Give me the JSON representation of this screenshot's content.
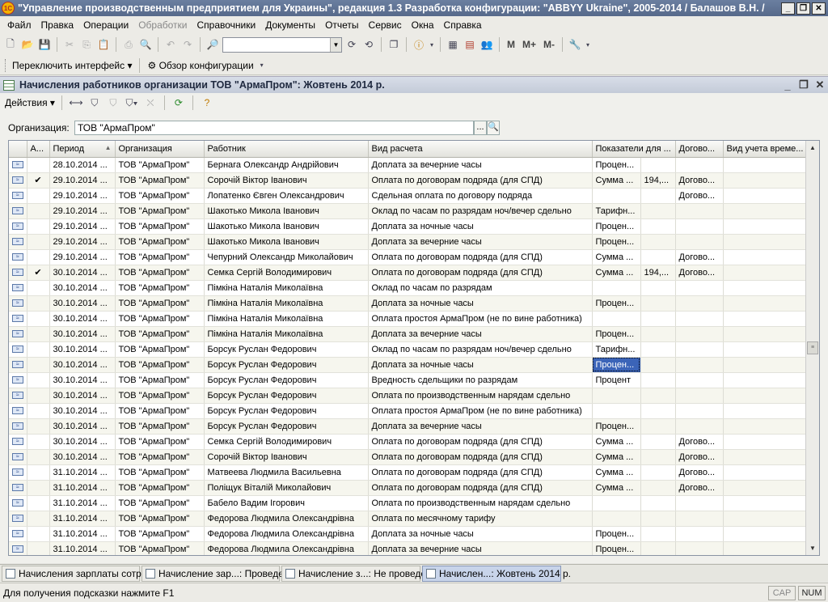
{
  "app": {
    "title": "\"Управление производственным предприятием для Украины\", редакция 1.3 Разработка конфигурации: \"ABBYY Ukraine\", 2005-2014 / Балашов В.Н. /",
    "logo_text": "1С"
  },
  "menu": [
    "Файл",
    "Правка",
    "Операции",
    "Обработки",
    "Справочники",
    "Документы",
    "Отчеты",
    "Сервис",
    "Окна",
    "Справка"
  ],
  "toolbar2": {
    "switch_interface": "Переключить интерфейс",
    "config_overview": "Обзор конфигурации"
  },
  "toolbar1": {
    "memory": [
      "M",
      "M+",
      "M-"
    ]
  },
  "document": {
    "title": "Начисления работников организации ТОВ \"АрмаПром\": Жовтень 2014 р.",
    "actions_label": "Действия",
    "org_label": "Организация:",
    "org_value": "ТОВ \"АрмаПром\"",
    "org_select": "...",
    "columns": [
      "А...",
      "Период",
      "Организация",
      "Работник",
      "Вид расчета",
      "Показатели для ...",
      "Догово...",
      "Вид учета време..."
    ],
    "rows": [
      {
        "a": "",
        "period": "28.10.2014 ...",
        "org": "ТОВ \"АрмаПром\"",
        "worker": "Бернага Олександр Андрійович",
        "calc": "Доплата за вечерние часы",
        "ind": "Процен...",
        "ind2": "",
        "contract": "",
        "time": ""
      },
      {
        "a": "✔",
        "period": "29.10.2014 ...",
        "org": "ТОВ \"АрмаПром\"",
        "worker": "Сорочій Віктор Іванович",
        "calc": "Оплата по договорам подряда (для СПД)",
        "ind": "Сумма ...",
        "ind2": "194,...",
        "contract": "Догово...",
        "time": ""
      },
      {
        "a": "",
        "period": "29.10.2014 ...",
        "org": "ТОВ \"АрмаПром\"",
        "worker": "Лопатенко Євген Олександрович",
        "calc": "Сдельная оплата по договору подряда",
        "ind": "",
        "ind2": "",
        "contract": "Догово...",
        "time": ""
      },
      {
        "a": "",
        "period": "29.10.2014 ...",
        "org": "ТОВ \"АрмаПром\"",
        "worker": "Шакотько Микола Іванович",
        "calc": "Оклад по часам по разрядам ноч/вечер сдельно",
        "ind": "Тарифн...",
        "ind2": "",
        "contract": "",
        "time": ""
      },
      {
        "a": "",
        "period": "29.10.2014 ...",
        "org": "ТОВ \"АрмаПром\"",
        "worker": "Шакотько Микола Іванович",
        "calc": "Доплата за ночные часы",
        "ind": "Процен...",
        "ind2": "",
        "contract": "",
        "time": ""
      },
      {
        "a": "",
        "period": "29.10.2014 ...",
        "org": "ТОВ \"АрмаПром\"",
        "worker": "Шакотько Микола Іванович",
        "calc": "Доплата за вечерние часы",
        "ind": "Процен...",
        "ind2": "",
        "contract": "",
        "time": ""
      },
      {
        "a": "",
        "period": "29.10.2014 ...",
        "org": "ТОВ \"АрмаПром\"",
        "worker": "Чепурний Олександр Миколайович",
        "calc": "Оплата по договорам подряда (для СПД)",
        "ind": "Сумма ...",
        "ind2": "",
        "contract": "Догово...",
        "time": ""
      },
      {
        "a": "✔",
        "period": "30.10.2014 ...",
        "org": "ТОВ \"АрмаПром\"",
        "worker": "Семка Сергій Володимирович",
        "calc": "Оплата по договорам подряда (для СПД)",
        "ind": "Сумма ...",
        "ind2": "194,...",
        "contract": "Догово...",
        "time": ""
      },
      {
        "a": "",
        "period": "30.10.2014 ...",
        "org": "ТОВ \"АрмаПром\"",
        "worker": "Пімкіна Наталія Миколаївна",
        "calc": "Оклад по часам по разрядам",
        "ind": "",
        "ind2": "",
        "contract": "",
        "time": ""
      },
      {
        "a": "",
        "period": "30.10.2014 ...",
        "org": "ТОВ \"АрмаПром\"",
        "worker": "Пімкіна Наталія Миколаївна",
        "calc": "Доплата за ночные часы",
        "ind": "Процен...",
        "ind2": "",
        "contract": "",
        "time": ""
      },
      {
        "a": "",
        "period": "30.10.2014 ...",
        "org": "ТОВ \"АрмаПром\"",
        "worker": "Пімкіна Наталія Миколаївна",
        "calc": "Оплата простоя АрмаПром (не по вине работника)",
        "ind": "",
        "ind2": "",
        "contract": "",
        "time": ""
      },
      {
        "a": "",
        "period": "30.10.2014 ...",
        "org": "ТОВ \"АрмаПром\"",
        "worker": "Пімкіна Наталія Миколаївна",
        "calc": "Доплата за вечерние часы",
        "ind": "Процен...",
        "ind2": "",
        "contract": "",
        "time": ""
      },
      {
        "a": "",
        "period": "30.10.2014 ...",
        "org": "ТОВ \"АрмаПром\"",
        "worker": "Борсук Руслан Федорович",
        "calc": "Оклад по часам по разрядам ноч/вечер сдельно",
        "ind": "Тарифн...",
        "ind2": "",
        "contract": "",
        "time": ""
      },
      {
        "a": "",
        "period": "30.10.2014 ...",
        "org": "ТОВ \"АрмаПром\"",
        "worker": "Борсук Руслан Федорович",
        "calc": "Доплата за ночные часы",
        "ind": "Процен...",
        "ind2": "",
        "contract": "",
        "time": "",
        "selected": true
      },
      {
        "a": "",
        "period": "30.10.2014 ...",
        "org": "ТОВ \"АрмаПром\"",
        "worker": "Борсук Руслан Федорович",
        "calc": "Вредность сдельщики по разрядам",
        "ind": "Процент",
        "ind2": "",
        "contract": "",
        "time": ""
      },
      {
        "a": "",
        "period": "30.10.2014 ...",
        "org": "ТОВ \"АрмаПром\"",
        "worker": "Борсук Руслан Федорович",
        "calc": "Оплата по производственным нарядам сдельно",
        "ind": "",
        "ind2": "",
        "contract": "",
        "time": ""
      },
      {
        "a": "",
        "period": "30.10.2014 ...",
        "org": "ТОВ \"АрмаПром\"",
        "worker": "Борсук Руслан Федорович",
        "calc": "Оплата простоя АрмаПром (не по вине работника)",
        "ind": "",
        "ind2": "",
        "contract": "",
        "time": ""
      },
      {
        "a": "",
        "period": "30.10.2014 ...",
        "org": "ТОВ \"АрмаПром\"",
        "worker": "Борсук Руслан Федорович",
        "calc": "Доплата за вечерние часы",
        "ind": "Процен...",
        "ind2": "",
        "contract": "",
        "time": ""
      },
      {
        "a": "",
        "period": "30.10.2014 ...",
        "org": "ТОВ \"АрмаПром\"",
        "worker": "Семка Сергій Володимирович",
        "calc": "Оплата по договорам подряда (для СПД)",
        "ind": "Сумма ...",
        "ind2": "",
        "contract": "Догово...",
        "time": ""
      },
      {
        "a": "",
        "period": "30.10.2014 ...",
        "org": "ТОВ \"АрмаПром\"",
        "worker": "Сорочій Віктор Іванович",
        "calc": "Оплата по договорам подряда (для СПД)",
        "ind": "Сумма ...",
        "ind2": "",
        "contract": "Догово...",
        "time": ""
      },
      {
        "a": "",
        "period": "31.10.2014 ...",
        "org": "ТОВ \"АрмаПром\"",
        "worker": "Матвеева Людмила Васильевна",
        "calc": "Оплата по договорам подряда (для СПД)",
        "ind": "Сумма ...",
        "ind2": "",
        "contract": "Догово...",
        "time": ""
      },
      {
        "a": "",
        "period": "31.10.2014 ...",
        "org": "ТОВ \"АрмаПром\"",
        "worker": "Поліщук Віталій Миколайович",
        "calc": "Оплата по договорам подряда (для СПД)",
        "ind": "Сумма ...",
        "ind2": "",
        "contract": "Догово...",
        "time": ""
      },
      {
        "a": "",
        "period": "31.10.2014 ...",
        "org": "ТОВ \"АрмаПром\"",
        "worker": "Бабело Вадим Ігорович",
        "calc": "Оплата по производственным нарядам сдельно",
        "ind": "",
        "ind2": "",
        "contract": "",
        "time": ""
      },
      {
        "a": "",
        "period": "31.10.2014 ...",
        "org": "ТОВ \"АрмаПром\"",
        "worker": "Федорова Людмила Олександрівна",
        "calc": "Оплата по месячному тарифу",
        "ind": "",
        "ind2": "",
        "contract": "",
        "time": ""
      },
      {
        "a": "",
        "period": "31.10.2014 ...",
        "org": "ТОВ \"АрмаПром\"",
        "worker": "Федорова Людмила Олександрівна",
        "calc": "Доплата за ночные часы",
        "ind": "Процен...",
        "ind2": "",
        "contract": "",
        "time": ""
      },
      {
        "a": "",
        "period": "31.10.2014 ...",
        "org": "ТОВ \"АрмаПром\"",
        "worker": "Федорова Людмила Олександрівна",
        "calc": "Доплата за вечерние часы",
        "ind": "Процен...",
        "ind2": "",
        "contract": "",
        "time": ""
      }
    ]
  },
  "taskbar": [
    {
      "label": "Начисления зарплаты сотр...",
      "active": false
    },
    {
      "label": "Начисление зар...: Проведен",
      "active": false
    },
    {
      "label": "Начисление з...: Не проведен",
      "active": false
    },
    {
      "label": "Начислен...: Жовтень 2014 р.",
      "active": true
    }
  ],
  "status": {
    "hint": "Для получения подсказки нажмите F1",
    "cap": "CAP",
    "num": "NUM"
  },
  "colors": {
    "selection": "#3b64b8",
    "title_bar": "#56698a"
  }
}
